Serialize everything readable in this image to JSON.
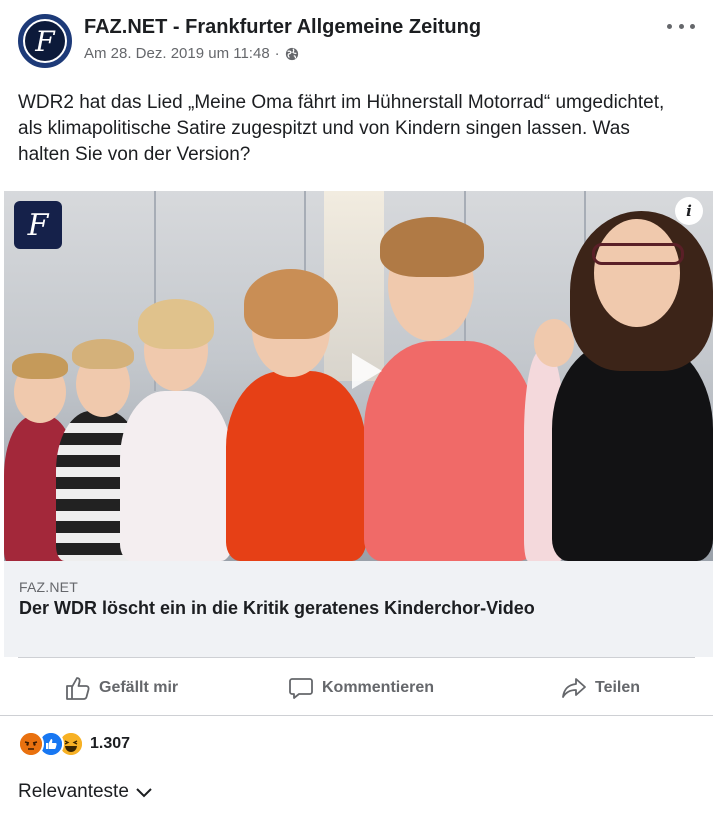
{
  "post": {
    "page_name": "FAZ.NET - Frankfurter Allgemeine Zeitung",
    "timestamp": "Am 28. Dez. 2019 um 11:48",
    "separator": "·",
    "audience_icon": "globe-icon",
    "text": "WDR2 hat das Lied „Meine Oma fährt im Hühnerstall Motorrad“ umgedichtet, als klimapolitische Satire zugespitzt und von Kindern singen lassen. Was halten Sie von der Version?",
    "avatar_letter": "F",
    "badge_letter": "F",
    "info_glyph": "i"
  },
  "link_preview": {
    "domain": "FAZ.NET",
    "title": "Der WDR löscht ein in die Kritik geratenes Kinderchor-Video"
  },
  "actions": {
    "like_label": "Gefällt mir",
    "comment_label": "Kommentieren",
    "share_label": "Teilen"
  },
  "reactions": {
    "types": [
      "angry",
      "like",
      "haha"
    ],
    "count": "1.307"
  },
  "comments": {
    "sort_label": "Relevanteste"
  },
  "colors": {
    "brand_navy": "#15214a",
    "text_primary": "#1c1e21",
    "text_secondary": "#65676b",
    "like_blue": "#1877f2",
    "angry_orange": "#e9710f",
    "haha_yellow": "#f7b125"
  }
}
